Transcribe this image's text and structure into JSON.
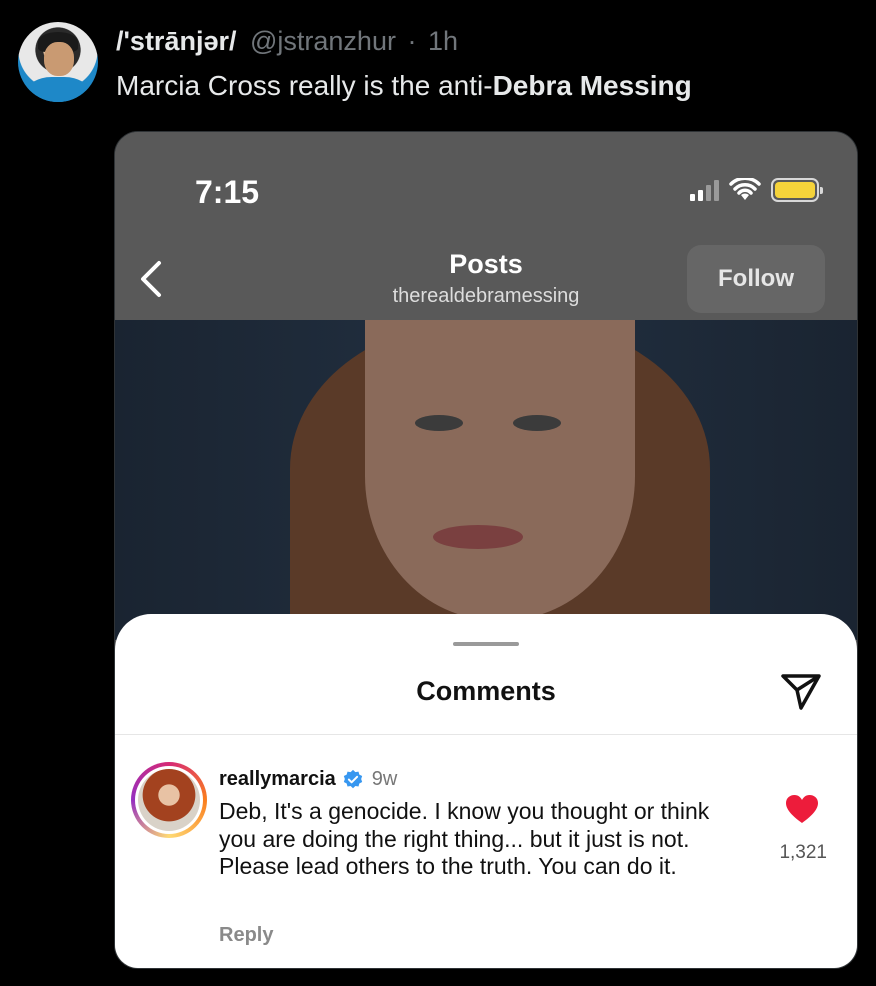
{
  "tweet": {
    "display_name": "/'strānjər/",
    "handle": "@jstranzhur",
    "separator": "·",
    "time_ago": "1h",
    "text_prefix": "Marcia Cross really is the anti-",
    "text_bold": "Debra Messing"
  },
  "screenshot": {
    "status_time": "7:15",
    "nav": {
      "back_icon": "chevron-left-icon",
      "title": "Posts",
      "subtitle": "therealdebramessing",
      "follow_label": "Follow"
    },
    "comments_sheet": {
      "title": "Comments",
      "comment": {
        "username": "reallymarcia",
        "age": "9w",
        "text": "Deb, It's a genocide. I know you thought or think you are doing the right thing... but it just is not. Please lead others to the truth. You can do it.",
        "reply_label": "Reply",
        "likes": "1,321"
      }
    }
  },
  "colors": {
    "background": "#000000",
    "handle_gray": "#71767b",
    "heart_red": "#ed1c3b",
    "verified_blue": "#3797f0",
    "battery_yellow": "#f5d33a"
  }
}
